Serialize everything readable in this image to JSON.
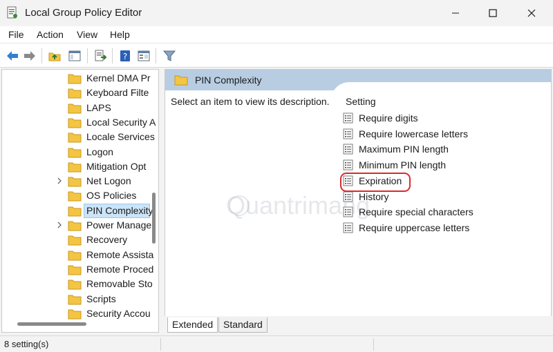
{
  "window": {
    "title": "Local Group Policy Editor"
  },
  "menu": {
    "items": [
      "File",
      "Action",
      "View",
      "Help"
    ]
  },
  "toolbar": {
    "icons": [
      "back-arrow-icon",
      "forward-arrow-icon",
      "up-folder-icon",
      "show-hide-tree-icon",
      "export-list-icon",
      "help-icon",
      "properties-icon",
      "filter-icon"
    ]
  },
  "tree": {
    "items": [
      {
        "label": "Kernel DMA Pr",
        "expandable": false,
        "selected": false
      },
      {
        "label": "Keyboard Filte",
        "expandable": false,
        "selected": false
      },
      {
        "label": "LAPS",
        "expandable": false,
        "selected": false
      },
      {
        "label": "Local Security A",
        "expandable": false,
        "selected": false
      },
      {
        "label": "Locale Services",
        "expandable": false,
        "selected": false
      },
      {
        "label": "Logon",
        "expandable": false,
        "selected": false
      },
      {
        "label": "Mitigation Opt",
        "expandable": false,
        "selected": false
      },
      {
        "label": "Net Logon",
        "expandable": true,
        "selected": false
      },
      {
        "label": "OS Policies",
        "expandable": false,
        "selected": false
      },
      {
        "label": "PIN Complexity",
        "expandable": false,
        "selected": true
      },
      {
        "label": "Power Manage",
        "expandable": true,
        "selected": false
      },
      {
        "label": "Recovery",
        "expandable": false,
        "selected": false
      },
      {
        "label": "Remote Assista",
        "expandable": false,
        "selected": false
      },
      {
        "label": "Remote Proced",
        "expandable": false,
        "selected": false
      },
      {
        "label": "Removable Sto",
        "expandable": false,
        "selected": false
      },
      {
        "label": "Scripts",
        "expandable": false,
        "selected": false
      },
      {
        "label": "Security Accou",
        "expandable": false,
        "selected": false
      }
    ]
  },
  "details": {
    "header_title": "PIN Complexity",
    "description": "Select an item to view its description.",
    "column_header": "Setting",
    "settings": [
      "Require digits",
      "Require lowercase letters",
      "Maximum PIN length",
      "Minimum PIN length",
      "Expiration",
      "History",
      "Require special characters",
      "Require uppercase letters"
    ],
    "highlighted": "Expiration"
  },
  "watermark": "Quantrimang",
  "tabs": {
    "extended": "Extended",
    "standard": "Standard"
  },
  "status": {
    "text": "8 setting(s)"
  },
  "colors": {
    "header_band": "#b8cde2",
    "selection": "#cce4f7",
    "highlight_ring": "#d92a2a",
    "folder": "#f4c542"
  }
}
